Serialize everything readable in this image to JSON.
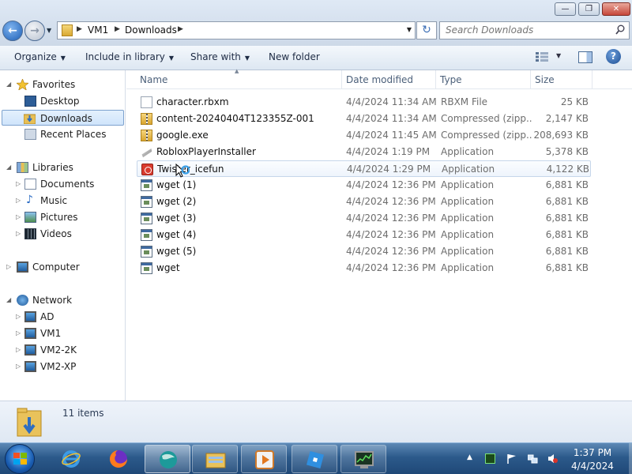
{
  "window": {
    "min_symbol": "—",
    "max_symbol": "❐",
    "close_symbol": "✕"
  },
  "navigation": {
    "back_symbol": "←",
    "forward_symbol": "→",
    "refresh_symbol": "↻",
    "breadcrumbs": [
      "VM1",
      "Downloads"
    ],
    "search_placeholder": "Search Downloads"
  },
  "toolbar": {
    "organize": "Organize",
    "include_in_library": "Include in library",
    "share_with": "Share with",
    "new_folder": "New folder",
    "help_symbol": "?"
  },
  "nav_pane": {
    "favorites": "Favorites",
    "desktop": "Desktop",
    "downloads": "Downloads",
    "recent_places": "Recent Places",
    "libraries": "Libraries",
    "documents": "Documents",
    "music": "Music",
    "pictures": "Pictures",
    "videos": "Videos",
    "computer": "Computer",
    "network": "Network",
    "ad": "AD",
    "vm1": "VM1",
    "vm2_2k": "VM2-2K",
    "vm2_xp": "VM2-XP"
  },
  "columns": {
    "name": "Name",
    "date_modified": "Date modified",
    "type": "Type",
    "size": "Size"
  },
  "files": [
    {
      "name": "character.rbxm",
      "date": "4/4/2024 11:34 AM",
      "type": "RBXM File",
      "size": "25 KB"
    },
    {
      "name": "content-20240404T123355Z-001",
      "date": "4/4/2024 11:34 AM",
      "type": "Compressed (zipp...",
      "size": "2,147 KB"
    },
    {
      "name": "google.exe",
      "date": "4/4/2024 11:45 AM",
      "type": "Compressed (zipp...",
      "size": "208,693 KB"
    },
    {
      "name": "RobloxPlayerInstaller",
      "date": "4/4/2024 1:19 PM",
      "type": "Application",
      "size": "5,378 KB"
    },
    {
      "name": "Twister_icefun",
      "date": "4/4/2024 1:29 PM",
      "type": "Application",
      "size": "4,122 KB"
    },
    {
      "name": "wget (1)",
      "date": "4/4/2024 12:36 PM",
      "type": "Application",
      "size": "6,881 KB"
    },
    {
      "name": "wget (2)",
      "date": "4/4/2024 12:36 PM",
      "type": "Application",
      "size": "6,881 KB"
    },
    {
      "name": "wget (3)",
      "date": "4/4/2024 12:36 PM",
      "type": "Application",
      "size": "6,881 KB"
    },
    {
      "name": "wget (4)",
      "date": "4/4/2024 12:36 PM",
      "type": "Application",
      "size": "6,881 KB"
    },
    {
      "name": "wget (5)",
      "date": "4/4/2024 12:36 PM",
      "type": "Application",
      "size": "6,881 KB"
    },
    {
      "name": "wget",
      "date": "4/4/2024 12:36 PM",
      "type": "Application",
      "size": "6,881 KB"
    }
  ],
  "details": {
    "item_count": "11 items"
  },
  "taskbar": {
    "time": "1:37 PM",
    "date": "4/4/2024"
  }
}
